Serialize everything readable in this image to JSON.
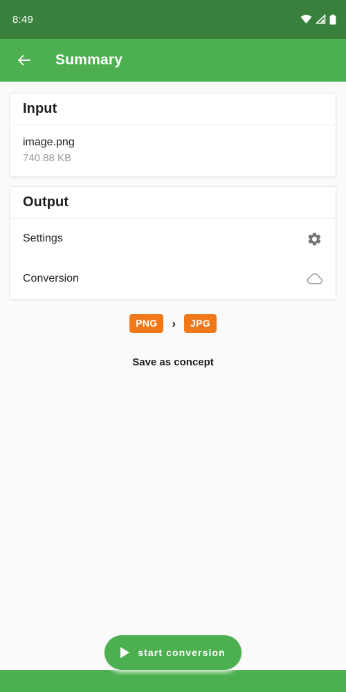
{
  "status_bar": {
    "time": "8:49",
    "icons": [
      "wifi-icon",
      "cell-signal-icon",
      "battery-icon"
    ],
    "background_color": "#38803B"
  },
  "app_bar": {
    "back_icon": "back-arrow-icon",
    "title": "Summary",
    "background_color": "#4CAF50"
  },
  "cards": {
    "input": {
      "header": "Input",
      "file_name": "image.png",
      "file_size": "740.88 KB"
    },
    "output": {
      "header": "Output",
      "rows": [
        {
          "label": "Settings",
          "icon": "gear-icon"
        },
        {
          "label": "Conversion",
          "icon": "cloud-icon"
        }
      ]
    }
  },
  "format_chips": {
    "source": "PNG",
    "arrow": "›",
    "target": "JPG",
    "chip_color": "#F07818"
  },
  "save_concept": {
    "label": "Save as concept"
  },
  "fab": {
    "label": "start conversion",
    "icon": "play-icon",
    "background_color": "#4CAF50"
  },
  "theme": {
    "page_background": "#FAFAFA",
    "card_background": "#FFFFFF",
    "icon_gray": "#757575"
  }
}
